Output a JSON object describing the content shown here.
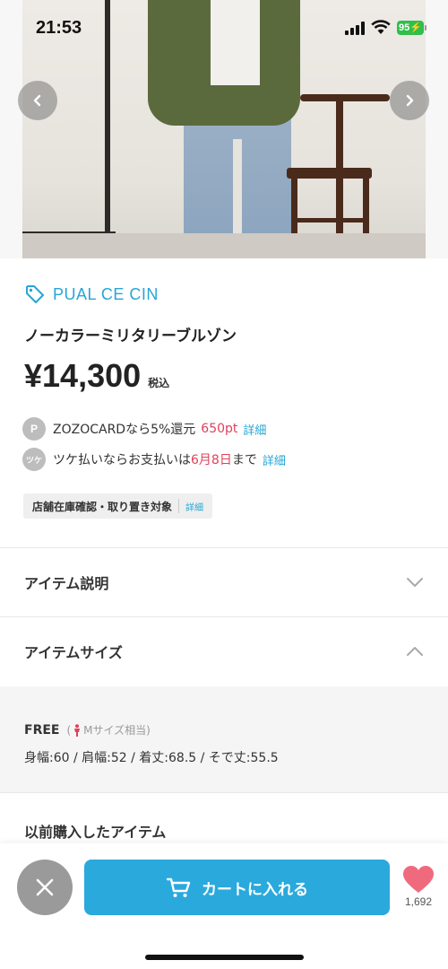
{
  "status_bar": {
    "time": "21:53",
    "battery": "95"
  },
  "brand": {
    "name": "PUAL CE CIN"
  },
  "product": {
    "title": "ノーカラーミリタリーブルゾン",
    "price": "¥14,300",
    "tax_label": "税込"
  },
  "points": {
    "icon_letter": "P",
    "text": "ZOZOCARDなら5%還元",
    "amount": "650pt",
    "link": "詳細"
  },
  "tsuke": {
    "icon_label": "ツケ",
    "text_before": "ツケ払いならお支払いは",
    "date": "6月8日",
    "text_after": "まで",
    "link": "詳細"
  },
  "store_tag": {
    "label": "店舗在庫確認・取り置き対象",
    "link": "詳細"
  },
  "sections": {
    "description": "アイテム説明",
    "size": "アイテムサイズ"
  },
  "size_info": {
    "size": "FREE",
    "note_open": "(",
    "note": "Mサイズ相当)",
    "dimensions": "身幅:60 / 肩幅:52 / 着丈:68.5 / そで丈:55.5"
  },
  "previous_items": {
    "title": "以前購入したアイテム"
  },
  "bottom_bar": {
    "cart_label": "カートに入れる",
    "favorite_count": "1,692"
  },
  "colors": {
    "accent": "#2aa9dd",
    "brand": "#27a6d6",
    "highlight": "#e0405a",
    "heart": "#f06a7e"
  }
}
